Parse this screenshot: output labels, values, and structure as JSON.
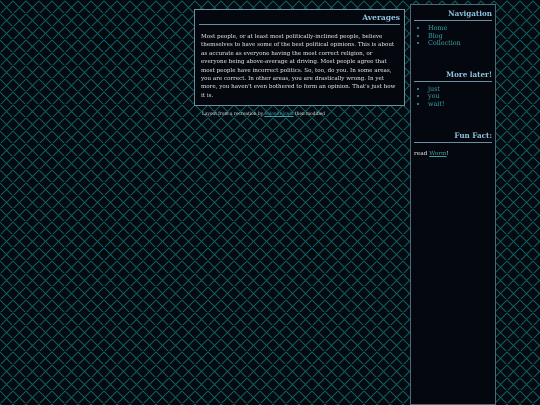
{
  "post": {
    "title": "Averages",
    "body": "Most people, or at least most politically-inclined people, believe themselves to have some of the best political opinions. This is about as accurate as everyone having the most correct religion, or everyone being above-average at driving. Most people agree that most people have incorrect politics. So, too, do you. In some areas, you are correct. In other areas, you are drastically wrong. In yet more, you haven't even bothered to form an opinion. That's just how it is."
  },
  "credits": {
    "prefix": "Layout from a recreation by",
    "link": "SeleniteJonin",
    "suffix": "then modified"
  },
  "sidebar": {
    "nav_title": "Navigation",
    "nav_items": [
      {
        "label": "Home"
      },
      {
        "label": "Blog"
      },
      {
        "label": "Collection"
      }
    ],
    "more_title": "More later!",
    "more_items": [
      {
        "label": "just"
      },
      {
        "label": "you"
      },
      {
        "label": "wait!"
      }
    ],
    "fun_title": "Fun Fact:",
    "fun_prefix": "read",
    "fun_link": "Worm",
    "fun_suffix": "!"
  },
  "colors": {
    "background": "#050a10",
    "pattern": "#0f5a5c",
    "heading": "#8fc3e0",
    "link": "#3aa0a8",
    "border": "#6c8fa0"
  }
}
